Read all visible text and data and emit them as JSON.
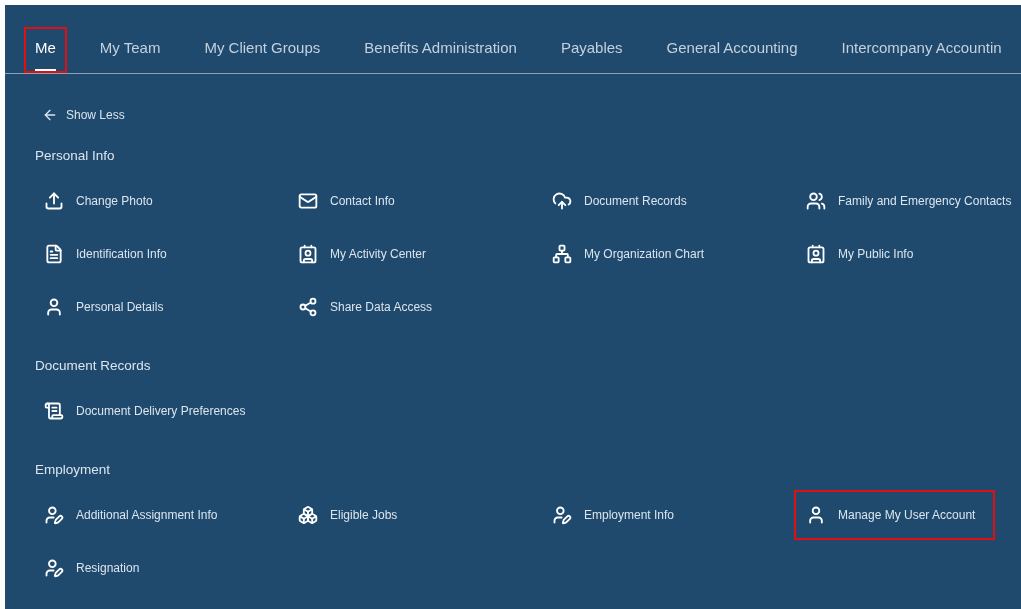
{
  "tabs": [
    {
      "label": "Me",
      "selected": true,
      "highlighted": true
    },
    {
      "label": "My Team",
      "selected": false,
      "highlighted": false
    },
    {
      "label": "My Client Groups",
      "selected": false,
      "highlighted": false
    },
    {
      "label": "Benefits Administration",
      "selected": false,
      "highlighted": false
    },
    {
      "label": "Payables",
      "selected": false,
      "highlighted": false
    },
    {
      "label": "General Accounting",
      "selected": false,
      "highlighted": false
    },
    {
      "label": "Intercompany Accountin",
      "selected": false,
      "highlighted": false
    }
  ],
  "show_less": "Show Less",
  "sections": [
    {
      "title": "Personal Info",
      "items": [
        {
          "label": "Change Photo",
          "kind": "upload",
          "highlighted": false
        },
        {
          "label": "Contact Info",
          "kind": "mail",
          "highlighted": false
        },
        {
          "label": "Document Records",
          "kind": "cloud",
          "highlighted": false
        },
        {
          "label": "Family and Emergency Contacts",
          "kind": "people",
          "highlighted": false
        },
        {
          "label": "Identification Info",
          "kind": "id-doc",
          "highlighted": false
        },
        {
          "label": "My Activity Center",
          "kind": "badge",
          "highlighted": false
        },
        {
          "label": "My Organization Chart",
          "kind": "org",
          "highlighted": false
        },
        {
          "label": "My Public Info",
          "kind": "badge",
          "highlighted": false
        },
        {
          "label": "Personal Details",
          "kind": "person",
          "highlighted": false
        },
        {
          "label": "Share Data Access",
          "kind": "share",
          "highlighted": false
        }
      ]
    },
    {
      "title": "Document Records",
      "items": [
        {
          "label": "Document Delivery Preferences",
          "kind": "doc",
          "highlighted": false
        }
      ]
    },
    {
      "title": "Employment",
      "items": [
        {
          "label": "Additional Assignment Info",
          "kind": "assign",
          "highlighted": false
        },
        {
          "label": "Eligible Jobs",
          "kind": "jobs",
          "highlighted": false
        },
        {
          "label": "Employment Info",
          "kind": "assign",
          "highlighted": false
        },
        {
          "label": "Manage My User Account",
          "kind": "person",
          "highlighted": true
        },
        {
          "label": "Resignation",
          "kind": "assign",
          "highlighted": false
        }
      ]
    }
  ]
}
